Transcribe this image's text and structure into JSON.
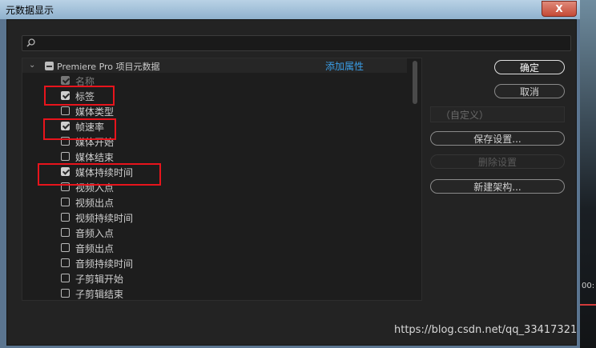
{
  "window": {
    "title": "元数据显示",
    "close_symbol": "X"
  },
  "search": {
    "value": "",
    "placeholder": ""
  },
  "tree": {
    "header_label": "Premiere Pro 项目元数据",
    "add_property_link": "添加属性",
    "items": [
      {
        "label": "名称",
        "checked": true,
        "disabled": true
      },
      {
        "label": "标签",
        "checked": true,
        "disabled": false
      },
      {
        "label": "媒体类型",
        "checked": false,
        "disabled": false
      },
      {
        "label": "帧速率",
        "checked": true,
        "disabled": false
      },
      {
        "label": "媒体开始",
        "checked": false,
        "disabled": false
      },
      {
        "label": "媒体结束",
        "checked": false,
        "disabled": false
      },
      {
        "label": "媒体持续时间",
        "checked": true,
        "disabled": false
      },
      {
        "label": "视频入点",
        "checked": false,
        "disabled": false
      },
      {
        "label": "视频出点",
        "checked": false,
        "disabled": false
      },
      {
        "label": "视频持续时间",
        "checked": false,
        "disabled": false
      },
      {
        "label": "音频入点",
        "checked": false,
        "disabled": false
      },
      {
        "label": "音频出点",
        "checked": false,
        "disabled": false
      },
      {
        "label": "音频持续时间",
        "checked": false,
        "disabled": false
      },
      {
        "label": "子剪辑开始",
        "checked": false,
        "disabled": false
      },
      {
        "label": "子剪辑结束",
        "checked": false,
        "disabled": false
      }
    ]
  },
  "buttons": {
    "ok": "确定",
    "cancel": "取消",
    "preset_value": "（自定义）",
    "save_settings": "保存设置...",
    "delete_settings": "删除设置",
    "new_schema": "新建架构..."
  },
  "background": {
    "timecode_fragment": "00:"
  },
  "watermark": "https://blog.csdn.net/qq_33417321",
  "colors": {
    "link": "#3a9ee8",
    "highlight": "#e8141c",
    "dialog_bg": "#232323"
  }
}
